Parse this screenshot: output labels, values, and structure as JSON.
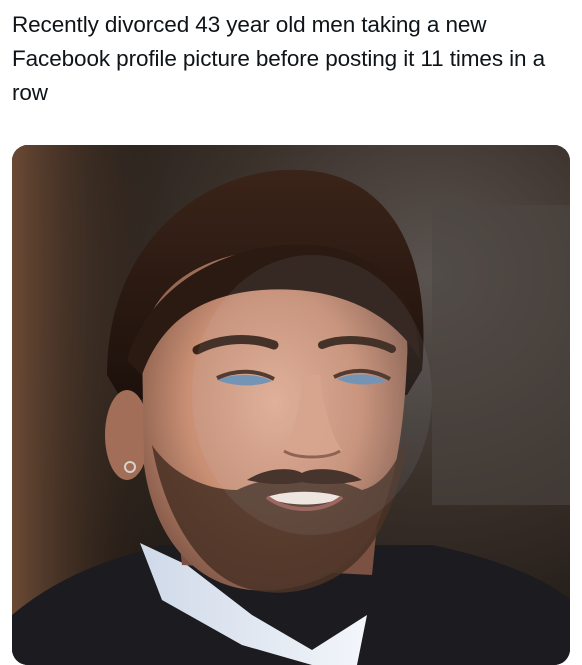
{
  "post": {
    "caption": "Recently divorced 43 year old men taking a new Facebook profile picture before posting it 11 times in a row"
  },
  "media": {
    "description_icon": "photo-of-man-lit-by-screen",
    "colors": {
      "background_dark": "#2a211b",
      "skin": "#c98f74",
      "hair": "#2b1a12",
      "beard": "#4a3226",
      "shirt": "#1c1b20",
      "collar": "#e8eef6"
    }
  }
}
